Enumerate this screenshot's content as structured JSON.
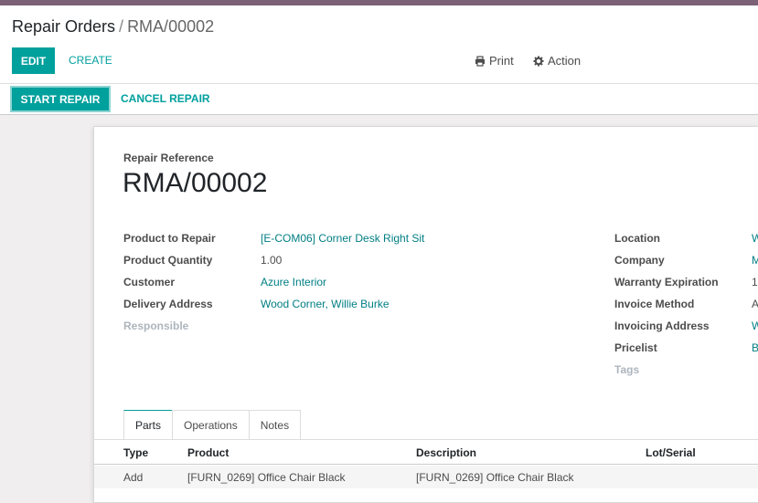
{
  "breadcrumb": {
    "parent": "Repair Orders",
    "separator": "/",
    "current": "RMA/00002"
  },
  "toolbar": {
    "edit_label": "EDIT",
    "create_label": "CREATE",
    "print_label": "Print",
    "action_label": "Action"
  },
  "statusbar": {
    "start_label": "START REPAIR",
    "cancel_label": "CANCEL REPAIR"
  },
  "form": {
    "ref_label": "Repair Reference",
    "ref_value": "RMA/00002",
    "left": [
      {
        "label": "Product to Repair",
        "value": "[E-COM06] Corner Desk Right Sit"
      },
      {
        "label": "Product Quantity",
        "value": "1.00"
      },
      {
        "label": "Customer",
        "value": "Azure Interior"
      },
      {
        "label": "Delivery Address",
        "value": "Wood Corner, Willie Burke"
      },
      {
        "label": "Responsible",
        "value": ""
      }
    ],
    "right": [
      {
        "label": "Location",
        "value": "W"
      },
      {
        "label": "Company",
        "value": "M"
      },
      {
        "label": "Warranty Expiration",
        "value": "1"
      },
      {
        "label": "Invoice Method",
        "value": "A"
      },
      {
        "label": "Invoicing Address",
        "value": "W"
      },
      {
        "label": "Pricelist",
        "value": "B"
      },
      {
        "label": "Tags",
        "value": ""
      }
    ]
  },
  "tabs": [
    {
      "label": "Parts"
    },
    {
      "label": "Operations"
    },
    {
      "label": "Notes"
    }
  ],
  "table": {
    "headers": [
      "Type",
      "Product",
      "Description",
      "Lot/Serial"
    ],
    "rows": [
      [
        "Add",
        "[FURN_0269] Office Chair Black",
        "[FURN_0269] Office Chair Black",
        ""
      ]
    ]
  },
  "colors": {
    "primary": "#00a09d",
    "link": "#017e84",
    "topbar": "#7c6177"
  }
}
